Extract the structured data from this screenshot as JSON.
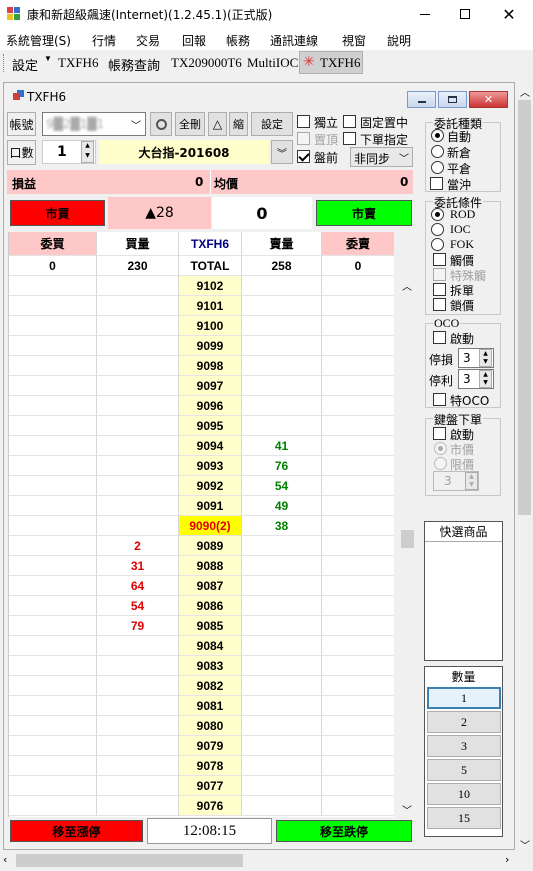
{
  "app": {
    "title": "康和新超級飆速(Internet)(1.2.45.1)(正式版)"
  },
  "menu": [
    "系統管理(S)",
    "行情",
    "交易",
    "回報",
    "帳務",
    "通訊連線",
    "視窗",
    "說明"
  ],
  "toolbar": {
    "settings": "設定",
    "tabs": [
      "TXFH6",
      "帳務查詢",
      "TX209000T6",
      "MultiIOC",
      "TXFH6"
    ]
  },
  "child": {
    "title": "TXFH6"
  },
  "account": {
    "label": "帳號",
    "value": "9█2█1█1",
    "delete_all": "全刪",
    "delta": "△",
    "shrink": "縮",
    "settings": "設定"
  },
  "qty": {
    "label": "口數",
    "value": "1"
  },
  "contract": {
    "name": "大台指-201608"
  },
  "opts": {
    "independent": "獨立",
    "fixed_center": "固定置中",
    "pin_top": "置頂",
    "order_specify": "下單指定",
    "pre_market": "盤前",
    "sync": "非同步"
  },
  "pnl": {
    "label": "損益",
    "value": "0",
    "avg_label": "均價",
    "avg_value": "0"
  },
  "market": {
    "buy": "市買",
    "change": "▲28",
    "position": "0",
    "sell": "市賣"
  },
  "ladder": {
    "headers": [
      "委買",
      "買量",
      "TXFH6",
      "賣量",
      "委賣"
    ],
    "totals": [
      "0",
      "230",
      "TOTAL",
      "258",
      "0"
    ],
    "rows": [
      {
        "bid_ord": "",
        "bid": "",
        "price": "9102",
        "ask": "",
        "ask_ord": ""
      },
      {
        "bid_ord": "",
        "bid": "",
        "price": "9101",
        "ask": "",
        "ask_ord": ""
      },
      {
        "bid_ord": "",
        "bid": "",
        "price": "9100",
        "ask": "",
        "ask_ord": ""
      },
      {
        "bid_ord": "",
        "bid": "",
        "price": "9099",
        "ask": "",
        "ask_ord": ""
      },
      {
        "bid_ord": "",
        "bid": "",
        "price": "9098",
        "ask": "",
        "ask_ord": ""
      },
      {
        "bid_ord": "",
        "bid": "",
        "price": "9097",
        "ask": "",
        "ask_ord": ""
      },
      {
        "bid_ord": "",
        "bid": "",
        "price": "9096",
        "ask": "",
        "ask_ord": ""
      },
      {
        "bid_ord": "",
        "bid": "",
        "price": "9095",
        "ask": "",
        "ask_ord": ""
      },
      {
        "bid_ord": "",
        "bid": "",
        "price": "9094",
        "ask": "41",
        "ask_ord": ""
      },
      {
        "bid_ord": "",
        "bid": "",
        "price": "9093",
        "ask": "76",
        "ask_ord": ""
      },
      {
        "bid_ord": "",
        "bid": "",
        "price": "9092",
        "ask": "54",
        "ask_ord": ""
      },
      {
        "bid_ord": "",
        "bid": "",
        "price": "9091",
        "ask": "49",
        "ask_ord": ""
      },
      {
        "bid_ord": "",
        "bid": "",
        "price": "9090(2)",
        "ask": "38",
        "ask_ord": ""
      },
      {
        "bid_ord": "",
        "bid": "2",
        "price": "9089",
        "ask": "",
        "ask_ord": ""
      },
      {
        "bid_ord": "",
        "bid": "31",
        "price": "9088",
        "ask": "",
        "ask_ord": ""
      },
      {
        "bid_ord": "",
        "bid": "64",
        "price": "9087",
        "ask": "",
        "ask_ord": ""
      },
      {
        "bid_ord": "",
        "bid": "54",
        "price": "9086",
        "ask": "",
        "ask_ord": ""
      },
      {
        "bid_ord": "",
        "bid": "79",
        "price": "9085",
        "ask": "",
        "ask_ord": ""
      },
      {
        "bid_ord": "",
        "bid": "",
        "price": "9084",
        "ask": "",
        "ask_ord": ""
      },
      {
        "bid_ord": "",
        "bid": "",
        "price": "9083",
        "ask": "",
        "ask_ord": ""
      },
      {
        "bid_ord": "",
        "bid": "",
        "price": "9082",
        "ask": "",
        "ask_ord": ""
      },
      {
        "bid_ord": "",
        "bid": "",
        "price": "9081",
        "ask": "",
        "ask_ord": ""
      },
      {
        "bid_ord": "",
        "bid": "",
        "price": "9080",
        "ask": "",
        "ask_ord": ""
      },
      {
        "bid_ord": "",
        "bid": "",
        "price": "9079",
        "ask": "",
        "ask_ord": ""
      },
      {
        "bid_ord": "",
        "bid": "",
        "price": "9078",
        "ask": "",
        "ask_ord": ""
      },
      {
        "bid_ord": "",
        "bid": "",
        "price": "9077",
        "ask": "",
        "ask_ord": ""
      },
      {
        "bid_ord": "",
        "bid": "",
        "price": "9076",
        "ask": "",
        "ask_ord": ""
      }
    ]
  },
  "bottom": {
    "limit_up": "移至漲停",
    "time": "12:08:15",
    "limit_down": "移至跌停"
  },
  "order_type": {
    "title": "委託種類",
    "auto": "自動",
    "new": "新倉",
    "close": "平倉",
    "day_trade": "當沖"
  },
  "order_cond": {
    "title": "委託條件",
    "rod": "ROD",
    "ioc": "IOC",
    "fok": "FOK",
    "trigger": "觸價",
    "special": "特殊觸",
    "split": "拆單",
    "lock": "鎖價"
  },
  "oco": {
    "title": "OCO",
    "enable": "啟動",
    "stop_loss_label": "停損",
    "stop_loss": "3",
    "take_profit_label": "停利",
    "take_profit": "3",
    "special": "特OCO"
  },
  "keyboard": {
    "title": "鍵盤下單",
    "enable": "啟動",
    "market": "市價",
    "limit": "限價",
    "qty": "3"
  },
  "quick": {
    "title": "快選商品"
  },
  "quantity": {
    "title": "數量",
    "options": [
      "1",
      "2",
      "3",
      "5",
      "10",
      "15"
    ]
  },
  "colors": {
    "buy": "#ff0000",
    "sell": "#00ff00",
    "pnl_bg": "#ffc8c8",
    "price_col": "#ffffcc",
    "current": "#ffff00"
  }
}
